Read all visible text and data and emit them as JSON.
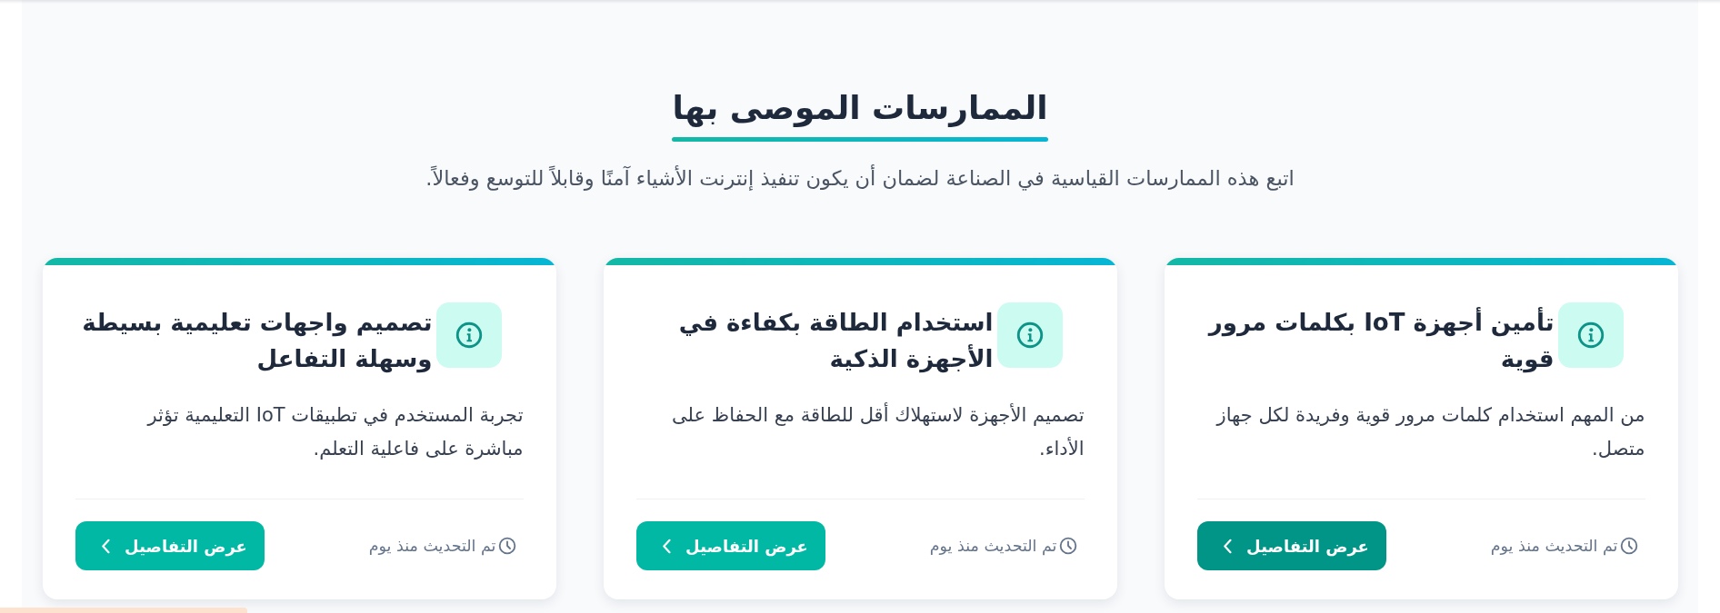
{
  "section": {
    "title": "الممارسات الموصى بها",
    "subtitle": "اتبع هذه الممارسات القياسية في الصناعة لضمان أن يكون تنفيذ إنترنت الأشياء آمنًا وقابلاً للتوسع وفعالاً."
  },
  "cards": [
    {
      "title": "تأمين أجهزة IoT بكلمات مرور قوية",
      "description": "من المهم استخدام كلمات مرور قوية وفريدة لكل جهاز متصل.",
      "updated": "تم التحديث منذ يوم",
      "button": {
        "label": "عرض التفاصيل",
        "hovered": true
      }
    },
    {
      "title": "استخدام الطاقة بكفاءة في الأجهزة الذكية",
      "description": "تصميم الأجهزة لاستهلاك أقل للطاقة مع الحفاظ على الأداء.",
      "updated": "تم التحديث منذ يوم",
      "button": {
        "label": "عرض التفاصيل",
        "hovered": false
      }
    },
    {
      "title": "تصميم واجهات تعليمية بسيطة وسهلة التفاعل",
      "description": "تجربة المستخدم في تطبيقات IoT التعليمية تؤثر مباشرة على فاعلية التعلم.",
      "updated": "تم التحديث منذ يوم",
      "button": {
        "label": "عرض التفاصيل",
        "hovered": false
      }
    }
  ]
}
